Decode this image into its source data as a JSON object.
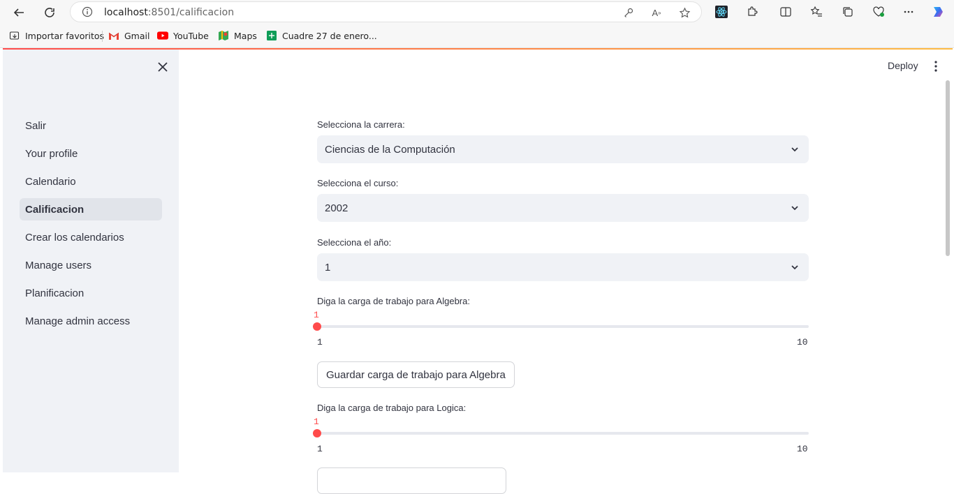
{
  "browser": {
    "url_host": "localhost",
    "url_path": ":8501/calificacion",
    "bookmarks": [
      {
        "label": "Importar favoritos",
        "icon": "import-favorites-icon"
      },
      {
        "label": "Gmail",
        "icon": "gmail-icon"
      },
      {
        "label": "YouTube",
        "icon": "youtube-icon"
      },
      {
        "label": "Maps",
        "icon": "maps-icon"
      },
      {
        "label": "Cuadre 27 de enero...",
        "icon": "sheets-icon"
      }
    ]
  },
  "header": {
    "deploy_label": "Deploy"
  },
  "sidebar": {
    "items": [
      {
        "label": "Salir",
        "active": false
      },
      {
        "label": "Your profile",
        "active": false
      },
      {
        "label": "Calendario",
        "active": false
      },
      {
        "label": "Calificacion",
        "active": true
      },
      {
        "label": "Crear los calendarios",
        "active": false
      },
      {
        "label": "Manage users",
        "active": false
      },
      {
        "label": "Planificacion",
        "active": false
      },
      {
        "label": "Manage admin access",
        "active": false
      }
    ]
  },
  "form": {
    "carrera": {
      "label": "Selecciona la carrera:",
      "value": "Ciencias de la Computación"
    },
    "curso": {
      "label": "Selecciona el curso:",
      "value": "2002"
    },
    "anio": {
      "label": "Selecciona el año:",
      "value": "1"
    },
    "sliders": [
      {
        "label": "Diga la carga de trabajo para Algebra:",
        "value": "1",
        "min": "1",
        "max": "10",
        "button": "Guardar carga de trabajo para Algebra"
      },
      {
        "label": "Diga la carga de trabajo para Logica:",
        "value": "1",
        "min": "1",
        "max": "10",
        "button": ""
      }
    ]
  },
  "colors": {
    "accent": "#ff4b4b",
    "sidebar_bg": "#f0f2f6",
    "text": "#31333f"
  }
}
